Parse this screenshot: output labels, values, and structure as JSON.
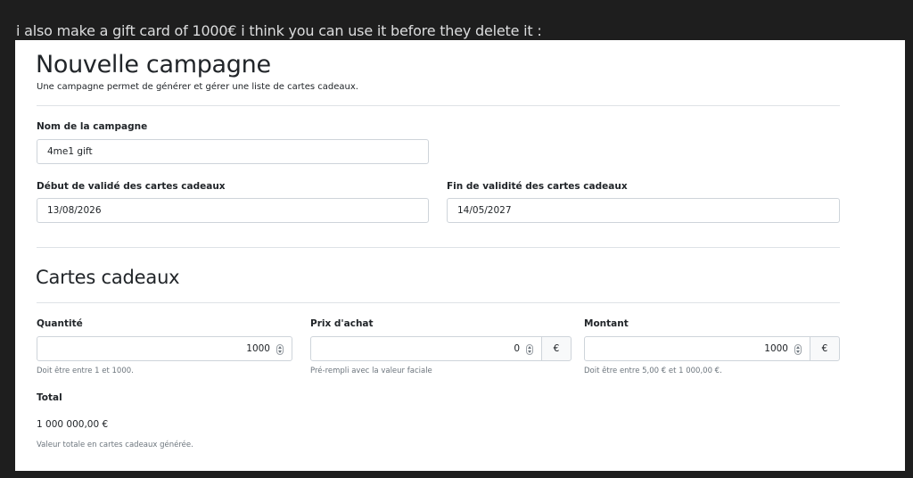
{
  "chat": {
    "message": "i also make a gift card of 1000€ i think you can use it before they delete it :"
  },
  "form": {
    "title": "Nouvelle campagne",
    "subtitle": "Une campagne permet de générer et gérer une liste de cartes cadeaux.",
    "name_label": "Nom de la campagne",
    "name_value": "4me1 gift",
    "start_label": "Début de validé des cartes cadeaux",
    "start_value": "13/08/2026",
    "end_label": "Fin de validité des cartes cadeaux",
    "end_value": "14/05/2027"
  },
  "cards": {
    "title": "Cartes cadeaux",
    "quantity_label": "Quantité",
    "quantity_value": "1000",
    "quantity_help": "Doit être entre 1 et 1000.",
    "price_label": "Prix d'achat",
    "price_value": "0",
    "price_currency": "€",
    "price_help": "Pré-rempli avec la valeur faciale",
    "amount_label": "Montant",
    "amount_value": "1000",
    "amount_currency": "€",
    "amount_help": "Doit être entre 5,00 € et 1 000,00 €.",
    "total_label": "Total",
    "total_value": "1 000 000,00 €",
    "total_help": "Valeur totale en cartes cadeaux générée."
  }
}
